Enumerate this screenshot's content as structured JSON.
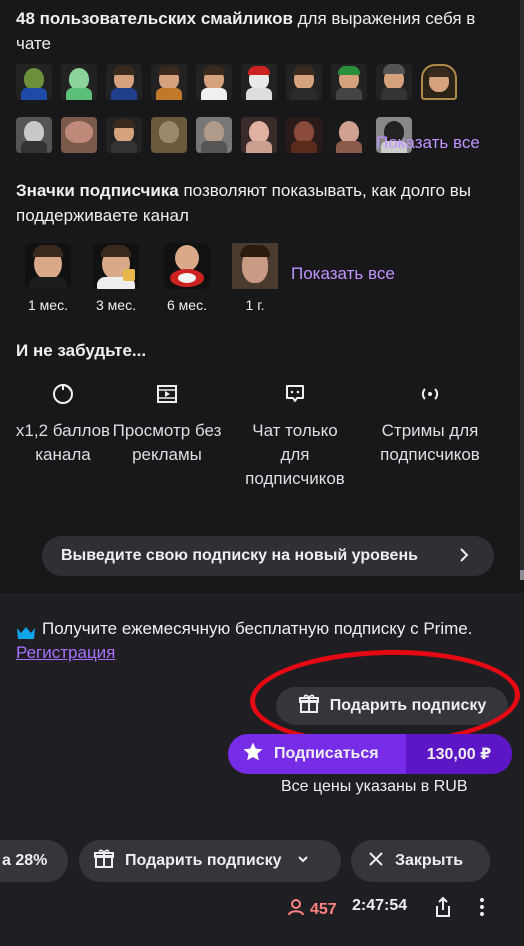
{
  "emotes": {
    "title_bold": "48 пользовательских смайликов",
    "title_rest": " для выражения себя в чате",
    "show_all": "Показать все"
  },
  "badges": {
    "title_bold": "Значки подписчика",
    "title_rest": " позволяют показывать, как долго вы поддерживаете канал",
    "items": [
      {
        "label": "1 мес."
      },
      {
        "label": "3 мес."
      },
      {
        "label": "6 мес."
      },
      {
        "label": "1 г."
      }
    ],
    "show_all": "Показать все"
  },
  "perks": {
    "title": "И не забудьте...",
    "items": [
      {
        "icon": "channel-points-icon",
        "label": "x1,2 баллов канала"
      },
      {
        "icon": "ad-free-icon",
        "label": "Просмотр без рекламы"
      },
      {
        "icon": "sub-only-chat-icon",
        "label": "Чат только для подписчиков"
      },
      {
        "icon": "sub-only-streams-icon",
        "label": "Стримы для подписчиков"
      }
    ]
  },
  "upgrade_button": "Выведите свою подписку на новый уровень",
  "prime": {
    "text": "Получите ежемесячную бесплатную подписку с Prime.",
    "link": "Регистрация"
  },
  "gift_button": "Подарить подписку",
  "subscribe": {
    "label": "Подписаться",
    "price": "130,00 ₽"
  },
  "price_note": "Все цены указаны в RUB",
  "bottom_bar": {
    "discount": "а 28%",
    "gift": "Подарить подписку",
    "close": "Закрыть"
  },
  "status": {
    "viewers": "457",
    "uptime": "2:47:54"
  },
  "colors": {
    "accent": "#9147ff",
    "link": "#bf94ff",
    "live_red": "#ff8280",
    "annotation_red": "#e50914"
  }
}
